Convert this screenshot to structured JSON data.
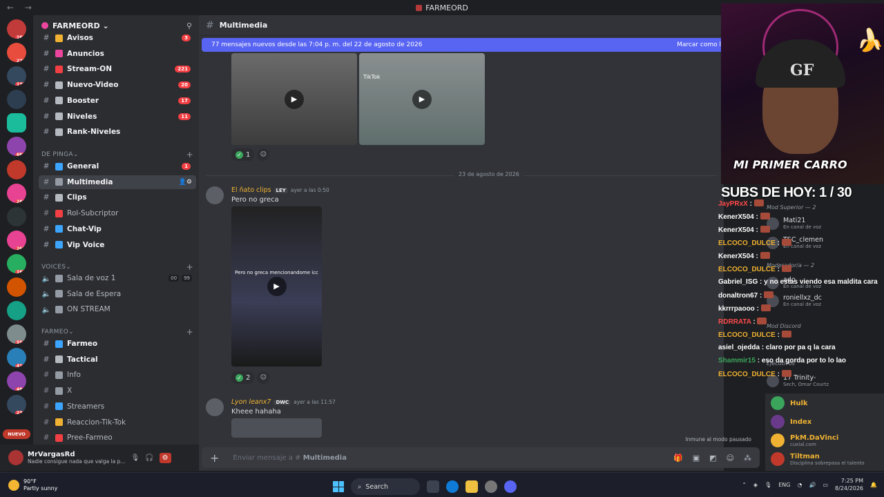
{
  "window": {
    "title": "FARMEORD",
    "nav": "← →"
  },
  "server": {
    "name": "FARMEORD"
  },
  "channels": [
    {
      "name": "Avisos",
      "count": "3",
      "bright": true,
      "color": "#f0b232"
    },
    {
      "name": "Anuncios",
      "count": "",
      "bright": true,
      "color": "#eb459e"
    },
    {
      "name": "Stream-ON",
      "count": "221",
      "bright": true,
      "color": "#f23f43"
    },
    {
      "name": "Nuevo-Video",
      "count": "20",
      "bright": true,
      "color": "#b5bac1"
    },
    {
      "name": "Booster",
      "count": "17",
      "bright": true,
      "color": "#b5bac1"
    },
    {
      "name": "Niveles",
      "count": "11",
      "bright": true,
      "color": "#b5bac1"
    },
    {
      "name": "Rank-Niveles",
      "count": "",
      "bright": true,
      "color": "#b5bac1"
    }
  ],
  "cat_de_pinga": "DE PINGA",
  "channels2": [
    {
      "name": "General",
      "count": "1",
      "bright": true,
      "color": "#3ba5ff"
    },
    {
      "name": "Multimedia",
      "count": "",
      "bright": true,
      "active": true,
      "color": "#949ba4"
    },
    {
      "name": "Clips",
      "count": "",
      "bright": true,
      "color": "#b5bac1"
    },
    {
      "name": "Rol-Subcriptor",
      "count": "",
      "bright": false,
      "color": "#f23f43"
    },
    {
      "name": "Chat-Vip",
      "count": "",
      "bright": true,
      "color": "#3ba5ff"
    },
    {
      "name": "Vip Voice",
      "count": "",
      "bright": true,
      "color": "#3ba5ff"
    }
  ],
  "cat_voices": "VOICES",
  "voice": [
    {
      "name": "Sala de voz 1",
      "a": "00",
      "b": "99"
    },
    {
      "name": "Sala de Espera"
    },
    {
      "name": "ON STREAM"
    }
  ],
  "cat_farmeo": "FARMEO",
  "channels3": [
    {
      "name": "Farmeo",
      "bright": true,
      "color": "#3ba5ff"
    },
    {
      "name": "Tactical",
      "bright": true,
      "color": "#b5bac1"
    },
    {
      "name": "Info",
      "bright": false,
      "color": "#949ba4"
    },
    {
      "name": "X",
      "bright": false,
      "color": "#949ba4"
    },
    {
      "name": "Streamers",
      "bright": false,
      "color": "#3ba5ff"
    },
    {
      "name": "Reaccion-Tik-Tok",
      "bright": false,
      "color": "#f0b232"
    },
    {
      "name": "Pree-Farmeo",
      "bright": false,
      "color": "#f23f43"
    }
  ],
  "rail_badges": [
    "1K+",
    "279",
    "130",
    "",
    "",
    "6K+",
    "",
    "283",
    "",
    "263",
    "1K+",
    "",
    "",
    "55",
    "41",
    "48",
    "23"
  ],
  "rail_new": "NUEVO",
  "user": {
    "name": "MrVargasRd",
    "status": "Nadie consigue nada que valga la p..."
  },
  "main": {
    "channel": "Multimedia",
    "banner": "77 mensajes nuevos desde las 7:04 p. m. del 22 de agosto de 2026",
    "banner_action": "Marcar como l",
    "tiktok": "TikTok",
    "react1": "1",
    "date_divider": "23 de agosto de 2026",
    "msg1": {
      "author": "El ñato clips",
      "tag": "LEY",
      "time": "ayer a las 0:50",
      "text": "Pero no greca",
      "video_caption": "Pero no greca mencionandome icc"
    },
    "react2": "2",
    "msg2": {
      "author": "Lyon leanx7",
      "tag": "DWC",
      "time": "ayer a las 11:57",
      "text": "Kheee hahaha"
    },
    "composer": "Enviar mensaje a #",
    "composer_channel": "Multimedia",
    "paused": "Inmune al modo pausado"
  },
  "overlay": {
    "cam_title": "MI PRIMER CARRO",
    "subs": "SUBS DE HOY: 1 / 30"
  },
  "chat": [
    {
      "u": "JayPRxX",
      "t": "",
      "c": "#ff4b4b"
    },
    {
      "u": "KenerX504",
      "t": "",
      "c": "#ffffff"
    },
    {
      "u": "KenerX504",
      "t": "",
      "c": "#ffffff"
    },
    {
      "u": "ELCOCO_DULCE",
      "t": "",
      "c": "#f0b232"
    },
    {
      "u": "KenerX504",
      "t": "",
      "c": "#ffffff"
    },
    {
      "u": "ELCOCO_DULCE",
      "t": "",
      "c": "#f0b232"
    },
    {
      "u": "Gabriel_ISG",
      "t": "y no estas viendo esa maldita cara",
      "c": "#ffffff"
    },
    {
      "u": "donaltron67",
      "t": "",
      "c": "#ffffff"
    },
    {
      "u": "kkrrrpaooo",
      "t": "",
      "c": "#ffffff"
    },
    {
      "u": "RDRRATA",
      "t": "",
      "c": "#ff4b4b"
    },
    {
      "u": "ELCOCO_DULCE",
      "t": "",
      "c": "#f0b232"
    },
    {
      "u": "asiel_ojedda",
      "t": "claro por pa q la cara",
      "c": "#ffffff"
    },
    {
      "u": "Shammir15",
      "t": "eso da gorda por to lo lao",
      "c": "#3ba55c"
    },
    {
      "u": "ELCOCO_DULCE",
      "t": "",
      "c": "#f0b232"
    }
  ],
  "voice_panel": [
    {
      "n": "Mod Superior — 2",
      "s": ""
    },
    {
      "n": "Mati21",
      "s": "En canal de voz"
    },
    {
      "n": "TSC_clemen",
      "s": "En canal de voz"
    },
    {
      "n": "Moderador/a — 2",
      "s": ""
    },
    {
      "n": "ado",
      "s": "En canal de voz"
    },
    {
      "n": "roniellxz_dc",
      "s": "En canal de voz"
    },
    {
      "n": "Mod Discord",
      "s": ""
    },
    {
      "n": "Ejecutivos",
      "s": ""
    },
    {
      "n": "17 Trinity-",
      "s": "Sech, Omar Courtz"
    }
  ],
  "members": [
    {
      "n": "Hulk",
      "s": "",
      "c": "#f0b232"
    },
    {
      "n": "Index",
      "s": "",
      "c": "#f0b232"
    },
    {
      "n": "PkM.DaVinci",
      "s": "cuxial.com",
      "c": "#f0b232"
    },
    {
      "n": "Tiltman",
      "s": "Disciplina sobrepasa el talento",
      "c": "#f0b232"
    }
  ],
  "taskbar": {
    "temp": "90°F",
    "cond": "Partly sunny",
    "search": "Search",
    "lang": "ENG",
    "time": "7:25 PM",
    "date": "8/24/2026"
  }
}
